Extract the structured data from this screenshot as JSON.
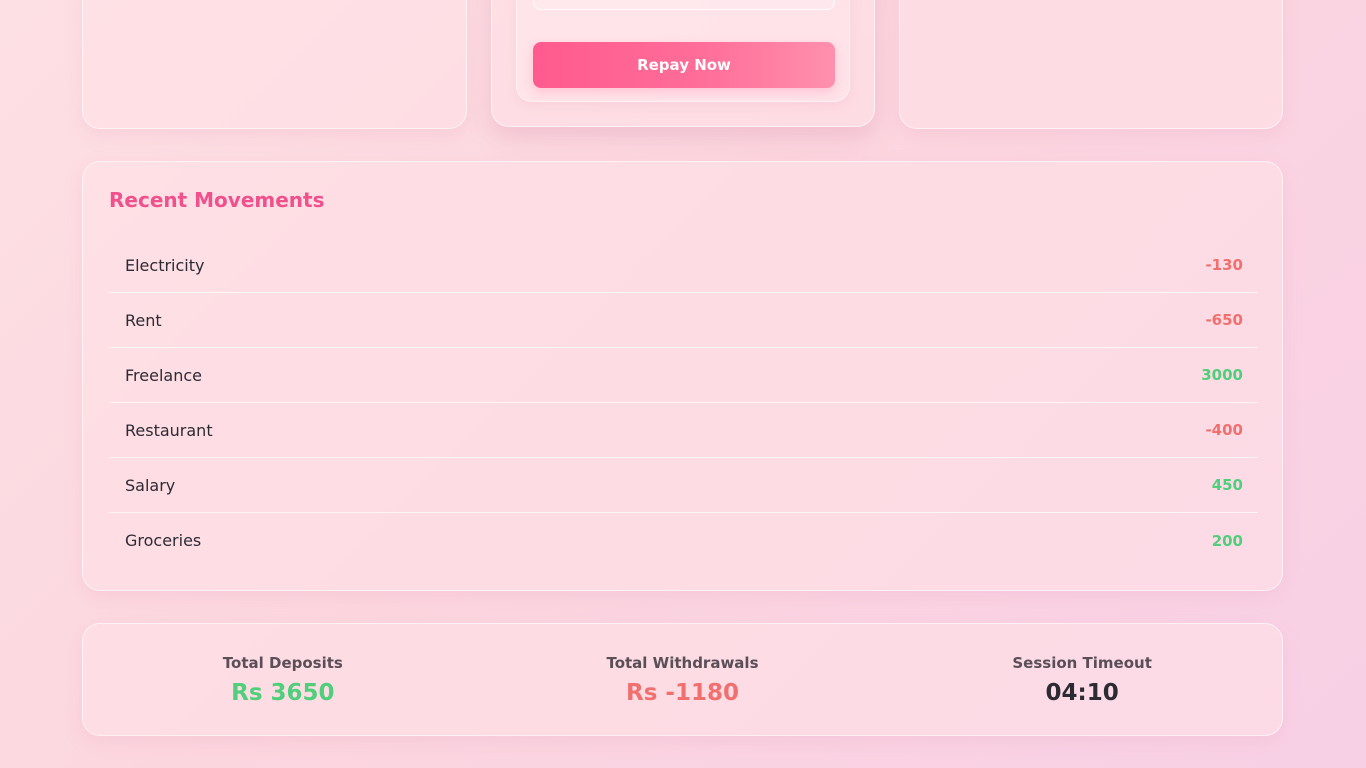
{
  "loan": {
    "repay_label": "Repay Now"
  },
  "movements": {
    "title": "Recent Movements",
    "items": [
      {
        "name": "Electricity",
        "amount": "-130",
        "kind": "withdrawal"
      },
      {
        "name": "Rent",
        "amount": "-650",
        "kind": "withdrawal"
      },
      {
        "name": "Freelance",
        "amount": "3000",
        "kind": "deposit"
      },
      {
        "name": "Restaurant",
        "amount": "-400",
        "kind": "withdrawal"
      },
      {
        "name": "Salary",
        "amount": "450",
        "kind": "deposit"
      },
      {
        "name": "Groceries",
        "amount": "200",
        "kind": "deposit"
      }
    ]
  },
  "summary": {
    "deposits_label": "Total Deposits",
    "deposits_value": "Rs 3650",
    "withdrawals_label": "Total Withdrawals",
    "withdrawals_value": "Rs -1180",
    "timeout_label": "Session Timeout",
    "timeout_value": "04:10"
  },
  "colors": {
    "accent": "#f0508c",
    "deposit": "#4fcf7b",
    "withdrawal": "#f0706f",
    "button": "#ff5a8f"
  }
}
